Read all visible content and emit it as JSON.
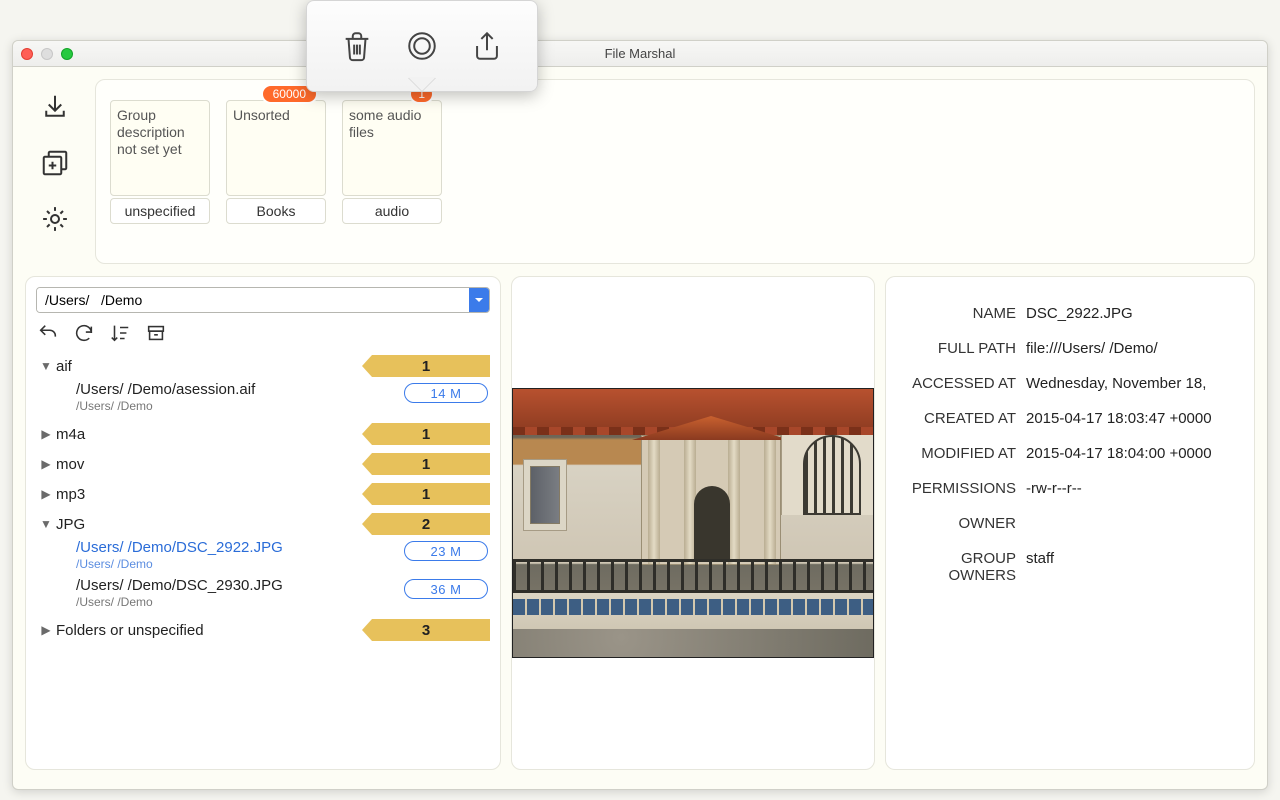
{
  "window": {
    "title": "File Marshal"
  },
  "popover": {
    "trash": "trash-icon",
    "record": "circle-icon",
    "share": "share-icon"
  },
  "groups": [
    {
      "desc": "Group description not set yet",
      "label": "unspecified",
      "badge": null
    },
    {
      "desc": "Unsorted",
      "label": "Books",
      "badge": "60000"
    },
    {
      "desc": "some audio files",
      "label": "audio",
      "badge": "1"
    }
  ],
  "path": "/Users/   /Demo",
  "tree": {
    "aif": {
      "count": "1",
      "expanded": true,
      "files": [
        {
          "path": "/Users/    /Demo/asession.aif",
          "sub": "/Users/    /Demo",
          "size": "14 M",
          "selected": false
        }
      ]
    },
    "m4a": {
      "count": "1",
      "expanded": false
    },
    "mov": {
      "count": "1",
      "expanded": false
    },
    "mp3": {
      "count": "1",
      "expanded": false
    },
    "JPG": {
      "count": "2",
      "expanded": true,
      "files": [
        {
          "path": "/Users/    /Demo/DSC_2922.JPG",
          "sub": "/Users/    /Demo",
          "size": "23 M",
          "selected": true
        },
        {
          "path": "/Users/    /Demo/DSC_2930.JPG",
          "sub": "/Users/    /Demo",
          "size": "36 M",
          "selected": false
        }
      ]
    },
    "folders": {
      "label": "Folders or unspecified",
      "count": "3",
      "expanded": false
    }
  },
  "meta": {
    "name_k": "NAME",
    "name_v": "DSC_2922.JPG",
    "path_k": "FULL PATH",
    "path_v": "file:///Users/    /Demo/",
    "acc_k": "ACCESSED AT",
    "acc_v": "Wednesday, November 18,",
    "crt_k": "CREATED AT",
    "crt_v": "2015-04-17 18:03:47 +0000",
    "mod_k": "MODIFIED AT",
    "mod_v": "2015-04-17 18:04:00 +0000",
    "perm_k": "PERMISSIONS",
    "perm_v": "-rw-r--r--",
    "own_k": "OWNER",
    "own_v": "",
    "grp_k": "GROUP OWNERS",
    "grp_v": "staff"
  }
}
